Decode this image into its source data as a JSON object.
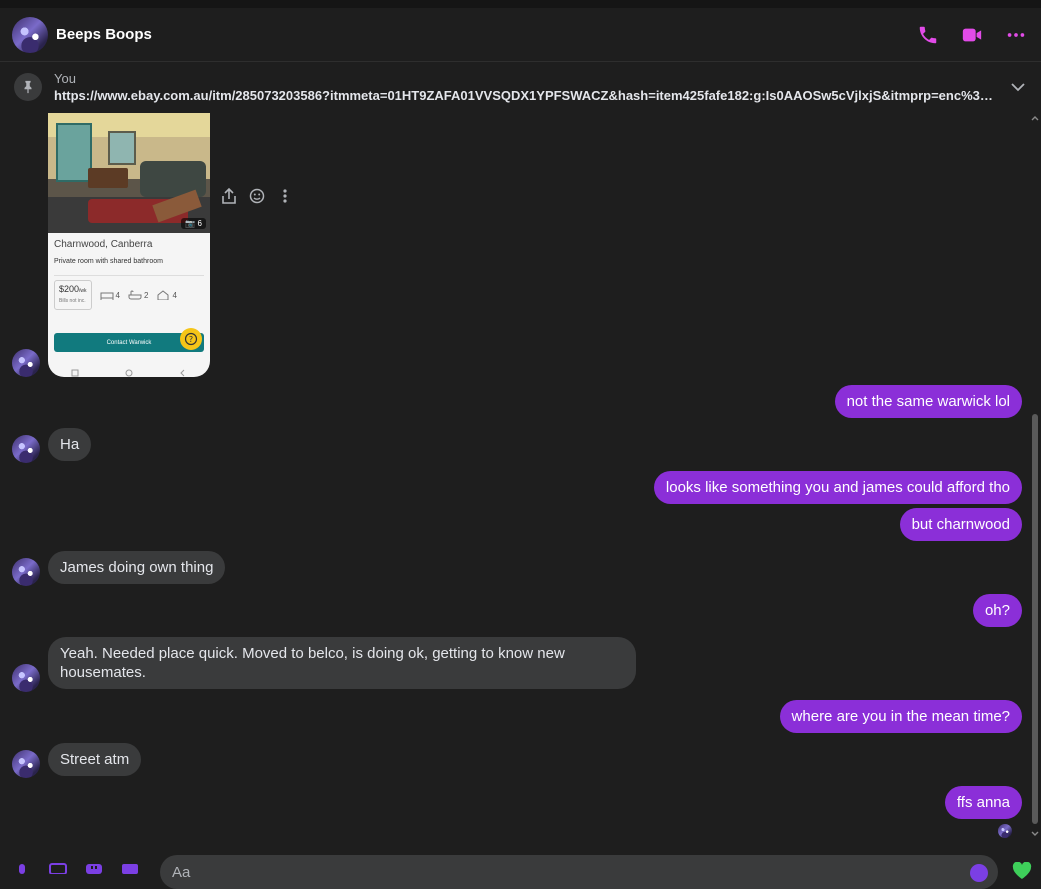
{
  "conversation": {
    "name": "Beeps Boops"
  },
  "header": {
    "actions": [
      "call-icon",
      "video-icon",
      "more-icon"
    ],
    "accent": "#e24be8"
  },
  "pinned": {
    "author": "You",
    "message": "https://www.ebay.com.au/itm/285073203586?itmmeta=01HT9ZAFA01VVSQDX1YPFSWACZ&hash=item425fafe182:g:Is0AAOSw5cVjlxjS&itmprp=enc%3AAQAJA..."
  },
  "listing_card": {
    "photo_count": "6",
    "location": "Charnwood, Canberra",
    "type": "Private room with shared bathroom",
    "price": "$200",
    "price_unit": "/wk",
    "price_note": "Bills not inc.",
    "beds": "4",
    "baths": "2",
    "rooms": "4",
    "contact_label": "Contact Warwick"
  },
  "messages": [
    {
      "from": "me",
      "text": "not the same warwick lol"
    },
    {
      "from": "them",
      "text": "Ha"
    },
    {
      "from": "me",
      "text": "looks like something you and james could afford tho"
    },
    {
      "from": "me",
      "text": "but charnwood"
    },
    {
      "from": "them",
      "text": "James doing own thing"
    },
    {
      "from": "me",
      "text": "oh?"
    },
    {
      "from": "them",
      "text": "Yeah. Needed place quick. Moved to belco, is doing ok, getting to know new housemates."
    },
    {
      "from": "me",
      "text": "where are you in the mean time?"
    },
    {
      "from": "them",
      "text": "Street atm"
    },
    {
      "from": "me",
      "text": "ffs anna"
    }
  ],
  "composer": {
    "placeholder": "Aa"
  },
  "colors": {
    "outgoing_bubble": "#8b2fd8",
    "incoming_bubble": "#3a3b3c",
    "background": "#1e1e1e"
  }
}
